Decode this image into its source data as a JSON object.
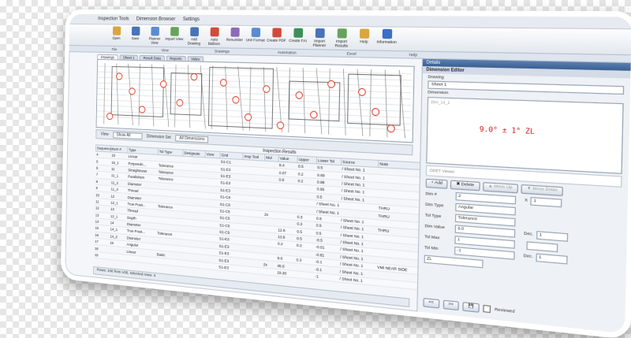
{
  "menubar": [
    "Inspection Tools",
    "Dimension Browser",
    "Settings"
  ],
  "ribbon": {
    "buttons": [
      {
        "label": "Open",
        "icon": "folder-icon",
        "color": "#d9a640"
      },
      {
        "label": "Save",
        "icon": "save-icon",
        "color": "#4a72b8"
      },
      {
        "label": "Planner View",
        "icon": "planner-icon",
        "color": "#5b8ccf"
      },
      {
        "label": "Import View",
        "icon": "import-icon",
        "color": "#67a35a"
      },
      {
        "label": "Add Drawing",
        "icon": "add-drawing-icon",
        "color": "#4a72b8"
      },
      {
        "label": "Auto Balloon",
        "icon": "balloon-icon",
        "color": "#d24b3a"
      },
      {
        "label": "Renumber",
        "icon": "renumber-icon",
        "color": "#8b6bb8"
      },
      {
        "label": "Unit Format",
        "icon": "format-icon",
        "color": "#5b8ccf"
      },
      {
        "label": "Create PDF",
        "icon": "pdf-icon",
        "color": "#d24b3a"
      },
      {
        "label": "Create FAI",
        "icon": "fai-icon",
        "color": "#3d8f5a"
      },
      {
        "label": "Import Planner",
        "icon": "import-planner-icon",
        "color": "#4a72b8"
      },
      {
        "label": "Import Results",
        "icon": "import-results-icon",
        "color": "#67a35a"
      },
      {
        "label": "Help",
        "icon": "help-icon",
        "color": "#d9a640"
      },
      {
        "label": "Information",
        "icon": "info-icon",
        "color": "#3a6fc4"
      }
    ],
    "groups": [
      "File",
      "View",
      "Drawings",
      "Automation",
      "Excel",
      "Help"
    ]
  },
  "doc_tabs": [
    "Drawings",
    "Sheet 1",
    "Result Data",
    "Reports",
    "Video"
  ],
  "grid_toolbar": {
    "view_label": "View",
    "view_value": "Show All",
    "dimset_label": "Dimension Set",
    "dimset_value": "All Dimensions"
  },
  "inspection_results_title": "Inspection Results",
  "table": {
    "headers": [
      "Sequence",
      "Item #",
      "Type",
      "Tol Type",
      "Designate",
      "View",
      "Grid",
      "Insp Tool",
      "Mul",
      "Value",
      "Upper",
      "Lower Tol",
      "Source",
      "Note"
    ],
    "rows": [
      [
        "4",
        "15",
        "Linear",
        "",
        "",
        "",
        "S1-C1",
        "",
        "",
        "8.4",
        "0.5",
        "0.5",
        "/ Sheet No. 1",
        ""
      ],
      [
        "5",
        "15_1",
        "Perpendic...",
        "Tolerance",
        "",
        "",
        "S1-E3",
        "",
        "",
        "0.07",
        "0.2",
        "0.69",
        "/ Sheet No. 1",
        ""
      ],
      [
        "6",
        "11",
        "Straightness",
        "Tolerance",
        "",
        "",
        "S1-E3",
        "",
        "",
        "0.8",
        "0.2",
        "0.88",
        "/ Sheet No. 1",
        ""
      ],
      [
        "7",
        "11_1",
        "Parallelism",
        "Tolerance",
        "",
        "",
        "S1-E3",
        "",
        "",
        "",
        "",
        "0.95",
        "/ Sheet No. 1",
        ""
      ],
      [
        "8",
        "11_2",
        "Diameter",
        "",
        "",
        "",
        "S1-E3",
        "",
        "",
        "",
        "",
        "0.5",
        "/ Sheet No. 1",
        ""
      ],
      [
        "9",
        "11_3",
        "Thread",
        "",
        "",
        "",
        "S1-C8",
        "",
        "",
        "",
        "",
        "/ Sheet No. 1",
        "",
        "THRU"
      ],
      [
        "10",
        "12",
        "Diameter",
        "",
        "",
        "",
        "S1-C8",
        "",
        "",
        "",
        "",
        "/ Sheet No. 1",
        "",
        "THRU"
      ],
      [
        "11",
        "12_1",
        "True Posit...",
        "Tolerance",
        "",
        "",
        "S1-C5",
        "",
        "2x",
        "",
        "0.3",
        "0.5",
        "/ Sheet No. 1",
        ""
      ],
      [
        "12",
        "13",
        "Thread",
        "",
        "",
        "",
        "S1-C5",
        "",
        "",
        "",
        "0.3",
        "0.5",
        "/ Sheet No. 1",
        "THRU"
      ],
      [
        "13",
        "13_1",
        "Depth",
        "",
        "",
        "",
        "S1-C5",
        "",
        "",
        "12.6",
        "0.5",
        "0.5",
        "/ Sheet No. 1",
        ""
      ],
      [
        "14",
        "14",
        "Diameter",
        "",
        "",
        "",
        "S1-C5",
        "",
        "",
        "13.8",
        "0.5",
        "-0.5",
        "/ Sheet No. 1",
        ""
      ],
      [
        "15",
        "14_1",
        "True Posit...",
        "Tolerance",
        "",
        "",
        "S1-E3",
        "",
        "",
        "0.2",
        "0.2",
        "-0.01",
        "/ Sheet No. 1",
        ""
      ],
      [
        "16",
        "14_2",
        "Diameter",
        "",
        "",
        "",
        "S1-E3",
        "",
        "",
        "",
        "",
        "-0.81",
        "/ Sheet No. 1",
        ""
      ],
      [
        "17",
        "16",
        "Angular",
        "",
        "",
        "",
        "S1-E3",
        "",
        "",
        "9.6",
        "0.3",
        "-0.1",
        "/ Sheet No. 1",
        "VMI NEAR SIDE"
      ],
      [
        "18",
        "",
        "Linear",
        "Basic",
        "",
        "",
        "S1-E3",
        "",
        "2x",
        "45.6",
        "",
        "-0.1",
        "/ Sheet No. 1",
        ""
      ],
      [
        "19",
        "",
        "",
        "",
        "",
        "",
        "S1-E3",
        "",
        "",
        "19.30",
        "",
        "-1",
        "/ Sheet No. 1",
        ""
      ]
    ]
  },
  "status_text": "Rows: 106 from 106, selected rows: 4",
  "right_panel": {
    "header": "Details",
    "title": "Dimension Editor",
    "drawing_label": "Drawing",
    "drawing_value": "Sheet 1",
    "dimension_label": "Dimension",
    "preview_corner": "Dim_14_1",
    "preview_value": "9.0° ± 1° ZL",
    "odet_placeholder": "ODET Viewer",
    "buttons": [
      "Add",
      "Delete",
      "Move Up",
      "Move Down"
    ],
    "fields": [
      {
        "label": "Dim #",
        "value": "2",
        "side_label": "X",
        "side_value": "1"
      },
      {
        "label": "Dim Type",
        "value": "Angular"
      },
      {
        "label": "Tol Type",
        "value": "Tolerance"
      },
      {
        "label": "Dim Value",
        "value": "9.0",
        "side_label": "Dec.",
        "side_value": "1"
      },
      {
        "label": "Tol Max",
        "value": "1",
        "side_label": "",
        "side_value": ""
      },
      {
        "label": "Tol Min",
        "value": "-1",
        "side_label": "Dec.",
        "side_value": "1"
      }
    ],
    "zone_value": "ZL",
    "nav_prev": "<<",
    "nav_next": ">>",
    "reviewed_label": "Reviewed"
  },
  "colors": {
    "balloon": "#e0351f",
    "drawing_line": "#222222",
    "panel_header": "#3a5f92"
  }
}
